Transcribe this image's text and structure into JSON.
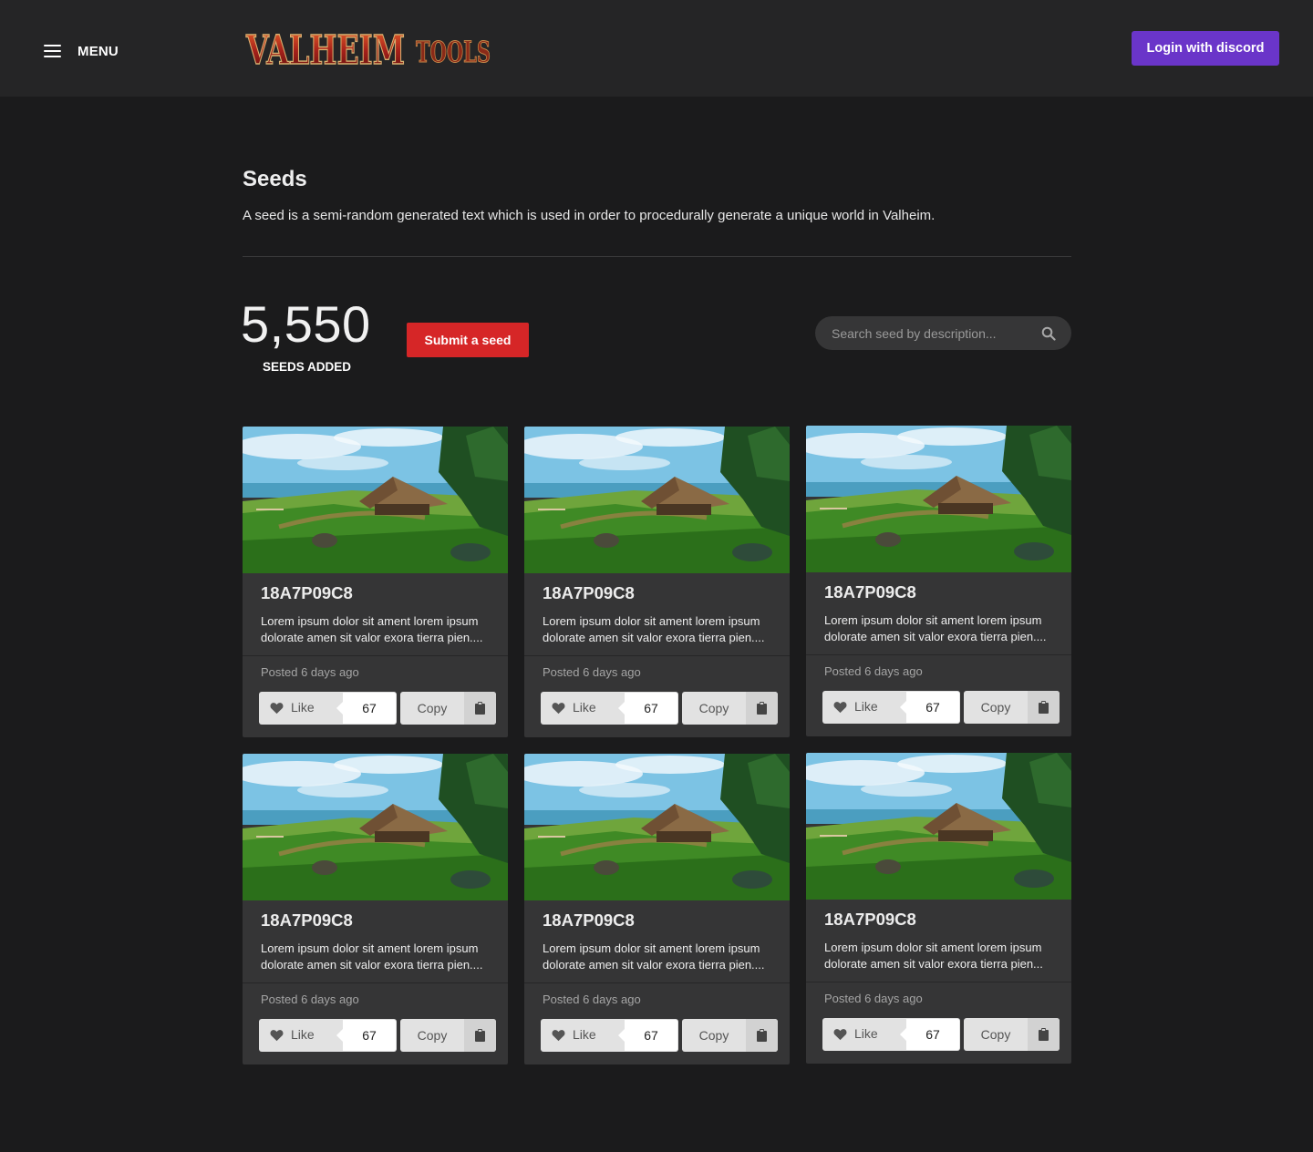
{
  "header": {
    "menu_label": "MENU",
    "logo_text_main": "VALHEIM",
    "logo_text_sub": "TOOLS",
    "login_label": "Login with discord"
  },
  "intro": {
    "title": "Seeds",
    "description": "A seed is a semi-random generated text which is used in order to procedurally generate a unique world in Valheim."
  },
  "stats": {
    "seed_count": "5,550",
    "seed_count_label": "SEEDS ADDED",
    "submit_label": "Submit a seed",
    "search_placeholder": "Search seed by description..."
  },
  "cards": [
    {
      "seed": "18A7P09C8",
      "description": "Lorem ipsum dolor sit ament lorem ipsum\ndolorate amen sit valor exora tierra pien....",
      "posted": "Posted 6 days ago",
      "like_label": "Like",
      "likes": "67",
      "copy_label": "Copy"
    },
    {
      "seed": "18A7P09C8",
      "description": "Lorem ipsum dolor sit ament lorem ipsum\ndolorate amen sit valor exora tierra pien....",
      "posted": "Posted 6 days ago",
      "like_label": "Like",
      "likes": "67",
      "copy_label": "Copy"
    },
    {
      "seed": "18A7P09C8",
      "description": "Lorem ipsum dolor sit ament lorem ipsum\ndolorate amen sit valor exora tierra pien....",
      "posted": "Posted 6 days ago",
      "like_label": "Like",
      "likes": "67",
      "copy_label": "Copy"
    },
    {
      "seed": "18A7P09C8",
      "description": "Lorem ipsum dolor sit ament lorem ipsum\ndolorate amen sit valor exora tierra pien....",
      "posted": "Posted 6 days ago",
      "like_label": "Like",
      "likes": "67",
      "copy_label": "Copy"
    },
    {
      "seed": "18A7P09C8",
      "description": "Lorem ipsum dolor sit ament lorem ipsum\ndolorate amen sit valor exora tierra pien....",
      "posted": "Posted 6 days ago",
      "like_label": "Like",
      "likes": "67",
      "copy_label": "Copy"
    },
    {
      "seed": "18A7P09C8",
      "description": "Lorem ipsum dolor sit ament lorem ipsum\ndolorate amen sit valor exora tierra pien...",
      "posted": "Posted 6 days ago",
      "like_label": "Like",
      "likes": "67",
      "copy_label": "Copy"
    }
  ],
  "icons": {
    "menu": "hamburger-icon",
    "search": "search-icon",
    "like": "heart-icon",
    "copy": "clipboard-icon"
  },
  "colors": {
    "page_bg": "#1b1b1c",
    "header_bg": "#252526",
    "card_bg": "#353536",
    "login_accent": "#6a35c9",
    "submit_accent": "#d62627"
  }
}
